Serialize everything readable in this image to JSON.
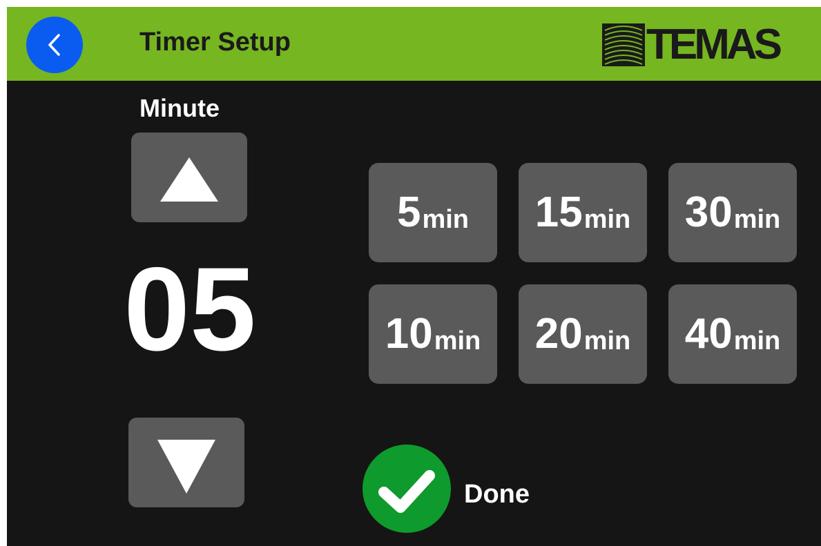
{
  "header": {
    "title": "Timer Setup",
    "logo_text": "TEMAS",
    "back_icon": "chevron-left-icon"
  },
  "colors": {
    "header_bg": "#76b621",
    "screen_bg": "#151515",
    "button_bg": "#5a5a5a",
    "back_button": "#0a5cf0",
    "done_button": "#0e9a2c"
  },
  "minute_picker": {
    "label": "Minute",
    "value": "05",
    "up_icon": "triangle-up-icon",
    "down_icon": "triangle-down-icon"
  },
  "presets": [
    {
      "value": "5",
      "unit": "min"
    },
    {
      "value": "15",
      "unit": "min"
    },
    {
      "value": "30",
      "unit": "min"
    },
    {
      "value": "10",
      "unit": "min"
    },
    {
      "value": "20",
      "unit": "min"
    },
    {
      "value": "40",
      "unit": "min"
    }
  ],
  "done": {
    "label": "Done",
    "icon": "checkmark-icon"
  }
}
